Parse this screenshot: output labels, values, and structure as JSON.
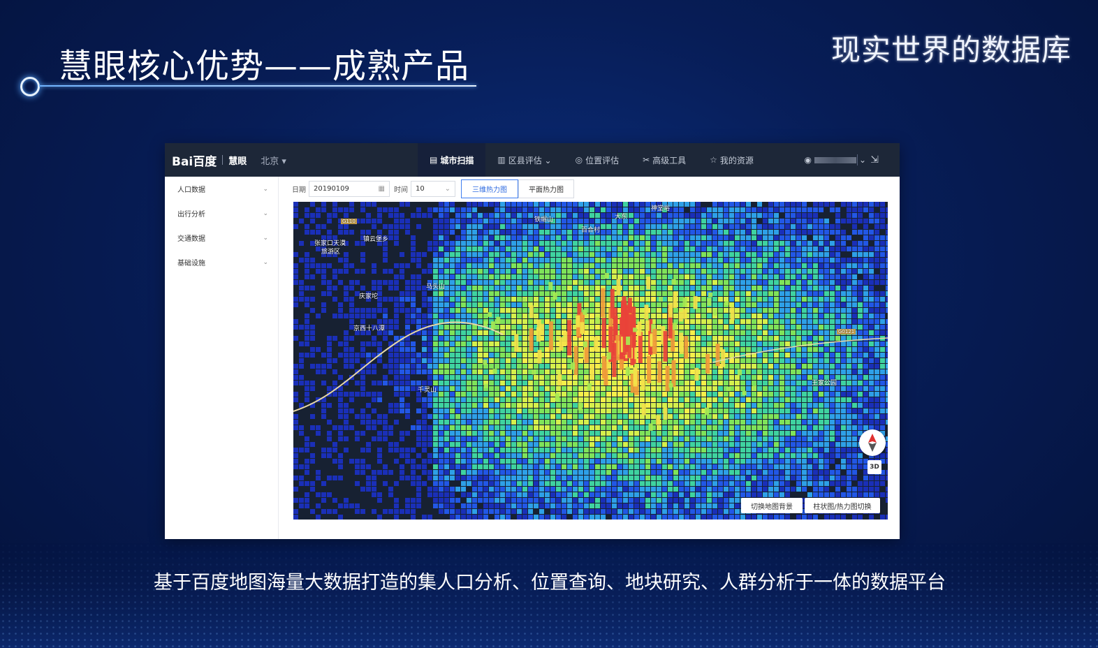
{
  "slide": {
    "title": "慧眼核心优势——成熟产品",
    "tagline": "现实世界的数据库",
    "caption": "基于百度地图海量大数据打造的集人口分析、位置查询、地块研究、人群分析于一体的数据平台"
  },
  "app": {
    "logo": {
      "brand": "Bai百度",
      "product": "慧眼"
    },
    "city": "北京 ▾",
    "nav": [
      {
        "icon": "scan-icon",
        "label": "城市扫描",
        "active": true
      },
      {
        "icon": "building-icon",
        "label": "区县评估 ⌄",
        "active": false
      },
      {
        "icon": "location-icon",
        "label": "位置评估",
        "active": false
      },
      {
        "icon": "tools-icon",
        "label": "高级工具",
        "active": false
      },
      {
        "icon": "star-icon",
        "label": "我的资源",
        "active": false
      }
    ],
    "sidebar": [
      {
        "label": "人口数据"
      },
      {
        "label": "出行分析"
      },
      {
        "label": "交通数据"
      },
      {
        "label": "基础设施"
      }
    ],
    "controls": {
      "date_label": "日期",
      "date_value": "20190109",
      "time_label": "时间",
      "time_value": "10",
      "btn_3d": "三维热力图",
      "btn_flat": "平面热力图"
    },
    "map": {
      "btn_bg": "切换地图背景",
      "btn_toggle": "柱状图/热力图切换",
      "three_d": "3D",
      "labels": [
        "铁帽山",
        "百合村",
        "张家口天漠",
        "旅游区",
        "镇云堡乡",
        "庆家坨",
        "马头山",
        "京西十八潭",
        "千灵山",
        "王家公园",
        "神堂峪",
        "大东",
        "G110",
        "G0121"
      ]
    }
  },
  "colors": {
    "bg_dark": "#04123b",
    "topbar": "#1d2738",
    "accent": "#3f7ef0"
  }
}
